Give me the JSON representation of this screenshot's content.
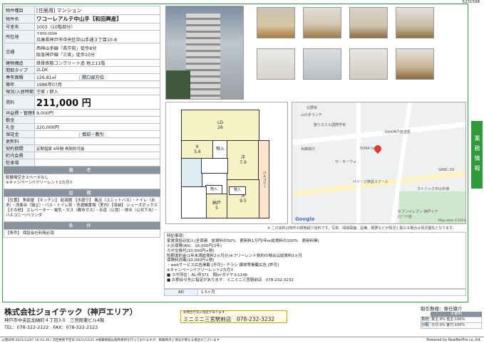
{
  "page_code": "5231598",
  "spec": {
    "rows_top": [
      {
        "k": "物件種目",
        "v": "[住居用] マンション"
      },
      {
        "k": "物件名",
        "v": "ワコーレアルテ中山手【和田興産】"
      },
      {
        "k": "号室名",
        "v": "1003（10階部分）"
      }
    ],
    "addr_label": "所在地",
    "addr_zip": "〒650-0004",
    "addr": "兵庫県神戸市中央区中山手通３丁目10-8",
    "traffic_label": "交通",
    "traffic1": "西神山手線「県庁前」徒歩8分",
    "traffic2": "阪急神戸線「三宮」徒歩10分",
    "struct_label": "建物構造",
    "struct": "鉄骨鉄筋コンクリート造 地上11階",
    "layout_label": "間取タイプ",
    "layout": "2LDK",
    "area_label": "専有面積",
    "area": "126.81㎡",
    "window_label": "開口部方位",
    "window": "",
    "built_label": "築年",
    "built": "1986年07月",
    "status_label": "現況/入居時期",
    "status": "空家 / 即入",
    "rent_label": "賃料",
    "rent": "211,000 円",
    "common_label": "共益費・管理費",
    "common": "9,000円",
    "deposit_label": "敷金",
    "deposit": "",
    "key_label": "礼金",
    "key": "220,000円",
    "guarantee_label": "保証金",
    "guarantee": "",
    "amort_label": "償却・敷引",
    "amort": "",
    "renew_label": "更新料",
    "renew": "",
    "contract_label": "契約期間",
    "contract": "定期借家 4年間 再契約可能",
    "town_label": "町内会費",
    "town": "",
    "parking_label": "駐車場",
    "parking": ""
  },
  "remarks": {
    "title": "備　考",
    "lines": [
      "駐輪場空きスペースなし",
      "※キャンペーン!!フリーレント2カ月!!"
    ]
  },
  "equip": {
    "title": "設　備",
    "text": "【位置】 角部屋 【キッチン】 給湯器 【水廻り】 風呂（ユニットバス）・トイレ（水洗）・洗面台（独立）・バス・トイレ別・洗濯機置場（室内）【収納】 シューズボックス 【その他】 エレベーター・電気・ガス（都市ガス）・水道（公営）・排水（公共下水）・バルコニー/ベランダ"
  },
  "conditions": {
    "title": "条　件",
    "text": "【条件】 保証会社利用必須"
  },
  "floorplan": {
    "ld": "LD",
    "ld_size": "26",
    "k": "K",
    "k_size": "5.6",
    "western1": "洋",
    "w1_size": "7.9",
    "western2": "洋",
    "w2_size": "9.5",
    "closet": "納戸",
    "closet_size": "5",
    "balcony": "バルコニー",
    "storage": "物入"
  },
  "map": {
    "labels": [
      "北野坂",
      "山の手ランチ",
      "聖ミカエル国際学校",
      "NHK神戸放送局",
      "SORA to",
      "ザ・モーヴェ",
      "ペリーズ英語スクール",
      "兵庫県庁",
      "SANC.39",
      "カトリック中山手通",
      "セブンイレブン 神戸トアロード店",
      "Map data ©2023"
    ],
    "badge": "Google"
  },
  "note": "※ この資料は物件の概略紹介資料です。写真、間取図面、設備、概要などが現況と異なる場合は現況優先となります。",
  "special": {
    "title": "特記事項：",
    "lines": [
      "家賃保証必加入(全保連　総賃料の50%　更新料1万円/年or総賃料の100%　更新料無)",
      "火災保険(AIG　16,000円/2年)",
      "カギ交換代(10,000円+税)",
      "短期違約金(1年未満総賃料2ヵ月分)※フリーレント契約の場合は総賃料3ヵ月",
      "保険料消毒(10,000円+税)",
      "・webサービス広告掲載 [不可]・チラシ 媒体等掲載広告 [許可]",
      "※キャンペーン!!フリーレント2カ月!!",
      "■ カギ所在：AL:呼371　問or'ダイヤル1146",
      "■ お問合せ先に指定があります：ミニミニ三宮駅前店　078-232-3232"
    ],
    "ad_label": "AD",
    "ad_value": "1.5ヶ月"
  },
  "company": {
    "name": "株式会社ジョイテック（神戸エリア）",
    "addr": "神戸市中央区加納町４丁目3-5　三宮館東ビル4階",
    "tel": "TEL：078-322-2122　FAX：078-322-2123"
  },
  "contact": {
    "note": "お問合せ先に指定があります",
    "name": "ミニミニ三宮駅前店",
    "tel": "078-232-3232"
  },
  "fee": {
    "title": "取引態様：専任媒介",
    "sub": "手数料",
    "r1_label": "負担",
    "r1": "貸主:0%  借主:100%",
    "r2_label": "分配",
    "r2": "元付:0%  客付:100%"
  },
  "footer": {
    "left": "公開日時:2021/12/07 16:43:39 / 次回更新予定日:2021/12/21 ※掲載情報は随時更新を行っておりますが、掲載時点と現況が異なる場合がございます",
    "right": "Powered by RealNetPro co.,ltd."
  },
  "side_tab": "業務情報",
  "colors": {
    "accent": "#2e9b3a",
    "header_bar": "#88939c",
    "rent": "#111111"
  }
}
